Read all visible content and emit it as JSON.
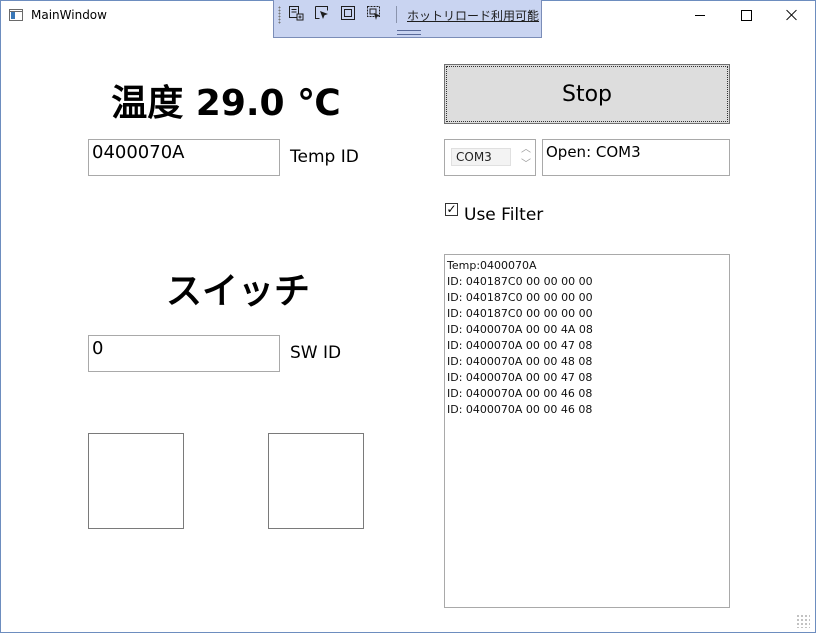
{
  "window": {
    "title": "MainWindow"
  },
  "hot_reload": {
    "label": "ホットリロード利用可能",
    "collapse": "‹"
  },
  "temperature": {
    "heading": "温度 29.0 ℃",
    "id_value": "0400070A",
    "id_label": "Temp ID"
  },
  "switch": {
    "heading": "スイッチ",
    "id_value": "0",
    "id_label": "SW ID"
  },
  "serial": {
    "stop_label": "Stop",
    "port": "COM3",
    "status": "Open: COM3",
    "use_filter_label": "Use Filter",
    "use_filter_checked": true
  },
  "log": {
    "lines": [
      "Temp:0400070A",
      "ID: 040187C0 00 00 00 00",
      "ID: 040187C0 00 00 00 00",
      "ID: 040187C0 00 00 00 00",
      "ID: 0400070A 00 00 4A 08",
      "ID: 0400070A 00 00 47 08",
      "ID: 0400070A 00 00 48 08",
      "ID: 0400070A 00 00 47 08",
      "ID: 0400070A 00 00 46 08",
      "ID: 0400070A 00 00 46 08"
    ]
  },
  "icons": {
    "app": "app-window-icon",
    "minimize": "minimize-icon",
    "maximize": "maximize-icon",
    "close": "close-icon",
    "hr_tools": [
      "live-visual-tree-icon",
      "select-element-icon",
      "display-layout-adorners-icon",
      "track-focused-element-icon"
    ]
  }
}
